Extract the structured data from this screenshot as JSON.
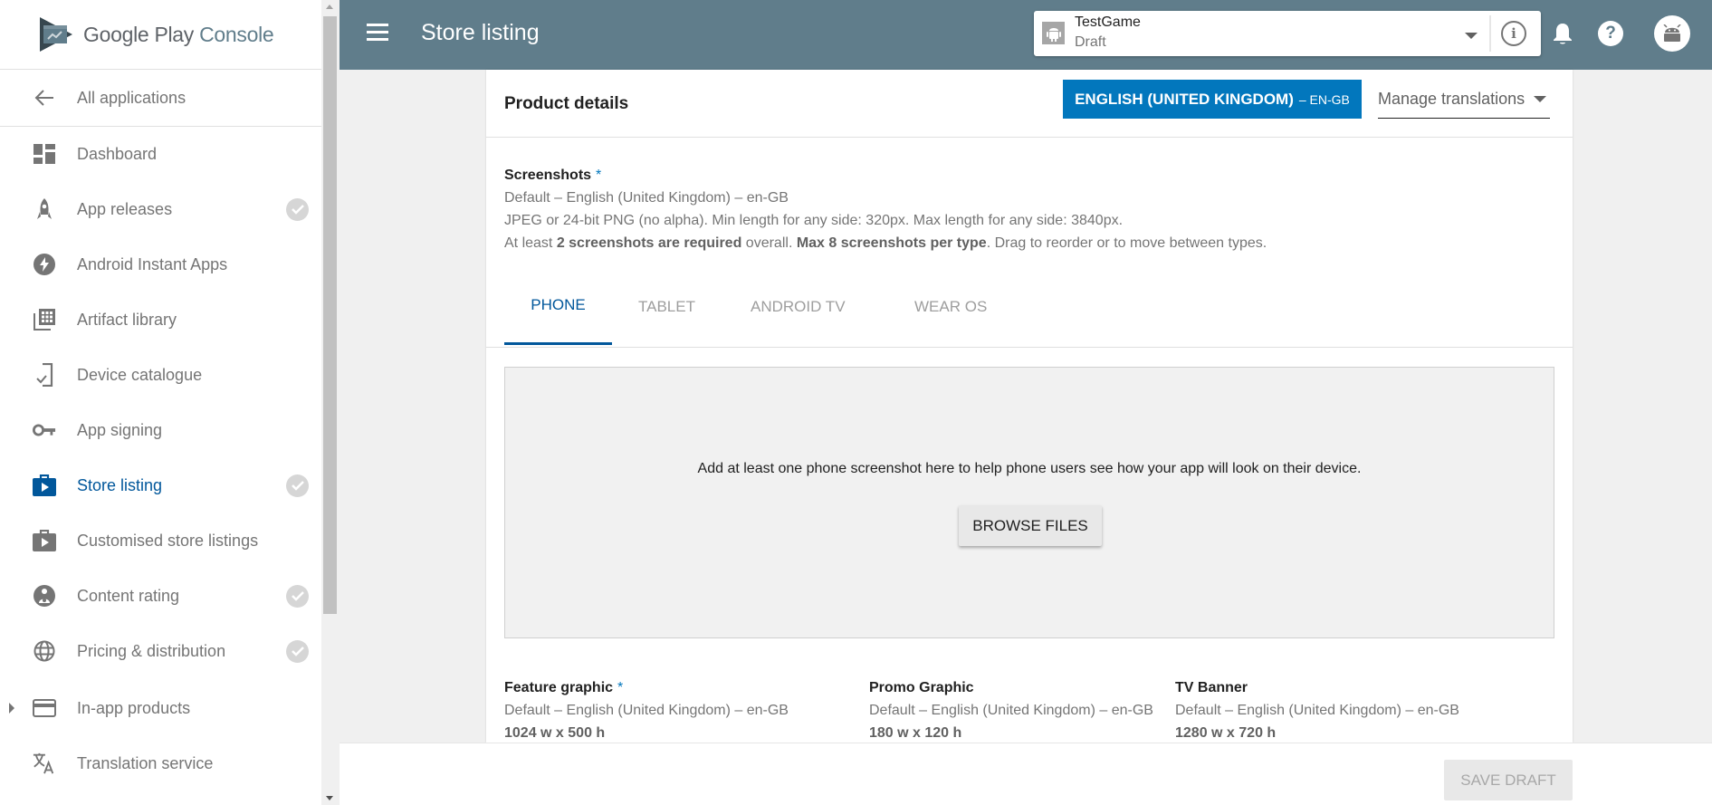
{
  "brand": {
    "name_part1": "Google Play",
    "name_part2": "Console"
  },
  "header": {
    "title": "Store listing",
    "app": {
      "name": "TestGame",
      "status": "Draft"
    }
  },
  "sidebar": {
    "back": {
      "label": "All applications",
      "icon": "arrow-back-icon"
    },
    "items": [
      {
        "label": "Dashboard",
        "icon": "dashboard-icon",
        "completed": false,
        "active": false
      },
      {
        "label": "App releases",
        "icon": "rocket-icon",
        "completed": true,
        "active": false
      },
      {
        "label": "Android Instant Apps",
        "icon": "instant-bolt-icon",
        "completed": false,
        "active": false
      },
      {
        "label": "Artifact library",
        "icon": "library-icon",
        "completed": false,
        "active": false
      },
      {
        "label": "Device catalogue",
        "icon": "device-check-icon",
        "completed": false,
        "active": false
      },
      {
        "label": "App signing",
        "icon": "key-icon",
        "completed": false,
        "active": false
      },
      {
        "label": "Store listing",
        "icon": "store-bag-icon",
        "completed": true,
        "active": true
      },
      {
        "label": "Customised store listings",
        "icon": "store-bag-icon",
        "completed": false,
        "active": false
      },
      {
        "label": "Content rating",
        "icon": "content-rating-icon",
        "completed": true,
        "active": false
      },
      {
        "label": "Pricing & distribution",
        "icon": "globe-icon",
        "completed": true,
        "active": false
      },
      {
        "label": "In-app products",
        "icon": "credit-card-icon",
        "completed": false,
        "active": false,
        "expandable": true
      },
      {
        "label": "Translation service",
        "icon": "translate-icon",
        "completed": false,
        "active": false
      }
    ]
  },
  "card": {
    "title": "Product details",
    "language_button": {
      "label": "ENGLISH (UNITED KINGDOM)",
      "code": "– EN-GB"
    },
    "manage_translations": "Manage translations",
    "screenshots": {
      "label": "Screenshots",
      "required_mark": "*",
      "locale": "Default – English (United Kingdom) – en-GB",
      "format_info": "JPEG or 24-bit PNG (no alpha). Min length for any side: 320px. Max length for any side: 3840px.",
      "rule_prefix": "At least ",
      "rule_bold1": "2 screenshots are required",
      "rule_mid": " overall. ",
      "rule_bold2": "Max 8 screenshots per type",
      "rule_suffix": ". Drag to reorder or to move between types."
    },
    "tabs": [
      {
        "label": "PHONE",
        "active": true
      },
      {
        "label": "TABLET",
        "active": false
      },
      {
        "label": "ANDROID TV",
        "active": false
      },
      {
        "label": "WEAR OS",
        "active": false
      }
    ],
    "drop_zone": {
      "message": "Add at least one phone screenshot here to help phone users see how your app will look on their device.",
      "browse_label": "BROWSE FILES"
    },
    "graphics": [
      {
        "label": "Feature graphic",
        "required": true,
        "locale": "Default – English (United Kingdom) – en-GB",
        "dimensions": "1024 w x 500 h"
      },
      {
        "label": "Promo Graphic",
        "required": false,
        "locale": "Default – English (United Kingdom) – en-GB",
        "dimensions": "180 w x 120 h"
      },
      {
        "label": "TV Banner",
        "required": false,
        "locale": "Default – English (United Kingdom) – en-GB",
        "dimensions": "1280 w x 720 h"
      }
    ]
  },
  "footer": {
    "save_draft": "SAVE DRAFT",
    "save_enabled": false
  },
  "colors": {
    "header_bg": "#607d8b",
    "accent": "#0277bd",
    "active_nav": "#01579b",
    "check_badge": "#d6d6d6"
  }
}
